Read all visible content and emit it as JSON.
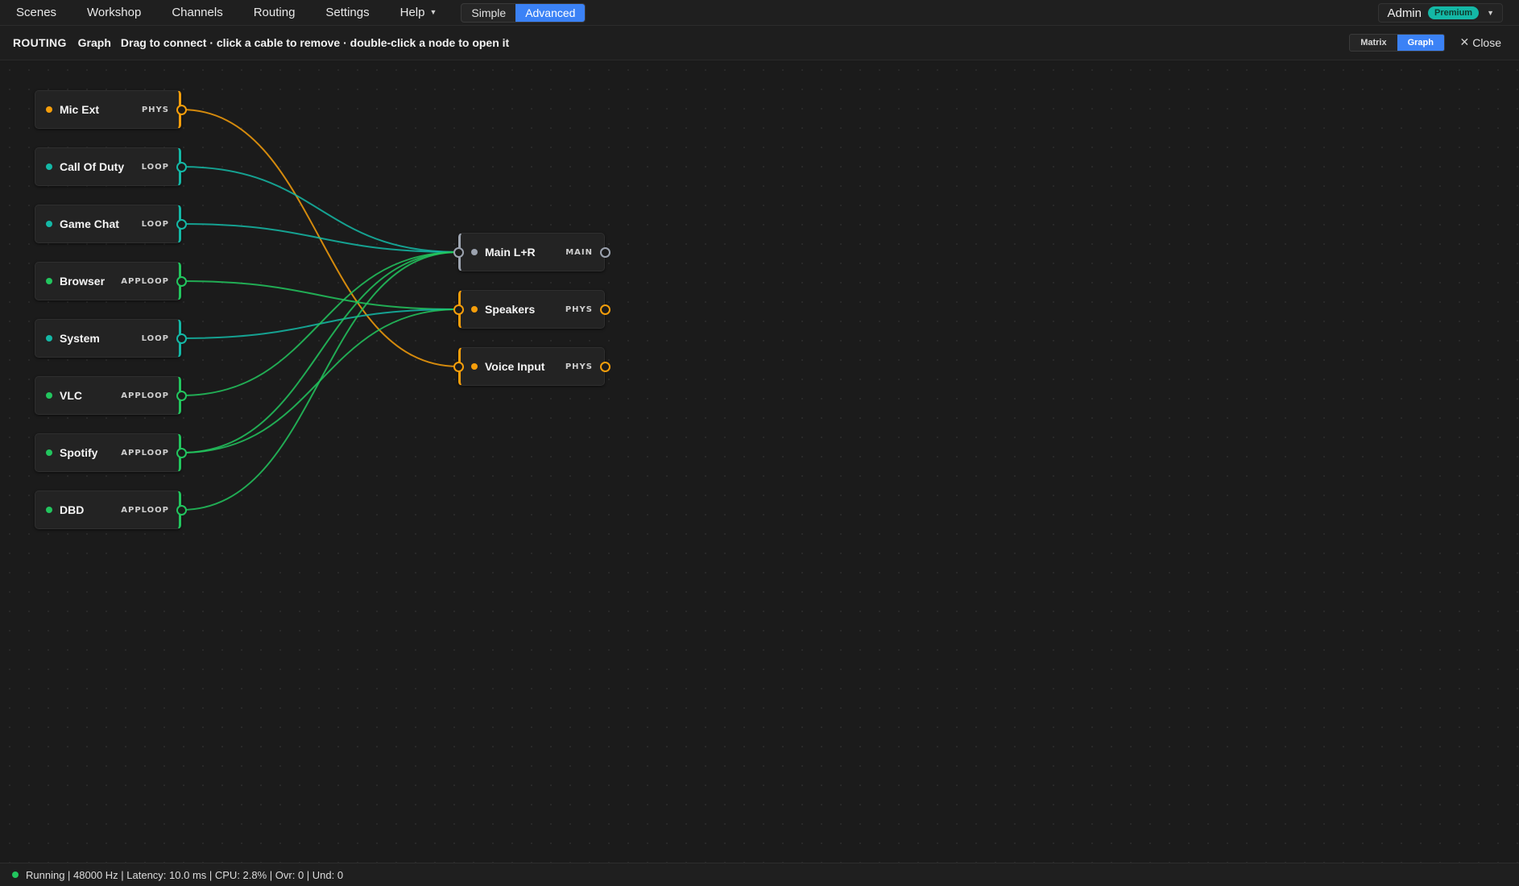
{
  "menu": {
    "items": [
      "Scenes",
      "Workshop",
      "Channels",
      "Routing",
      "Settings",
      "Help"
    ],
    "mode_simple": "Simple",
    "mode_advanced": "Advanced",
    "active_mode": "Advanced"
  },
  "account": {
    "name": "Admin",
    "badge": "Premium"
  },
  "routing_bar": {
    "title": "ROUTING",
    "subtitle": "Graph",
    "hint": "Drag to connect · click a cable to remove · double-click a node to open it",
    "view_matrix": "Matrix",
    "view_graph": "Graph",
    "active_view": "Graph",
    "close_label": "Close"
  },
  "colors": {
    "phys": "#f59e0b",
    "loop": "#14b8a6",
    "apploop": "#22c55e",
    "main": "#9ca3af",
    "accent": "#3b82f6"
  },
  "graph": {
    "sources": [
      {
        "id": "mic-ext",
        "label": "Mic Ext",
        "type": "PHYS",
        "kind": "phys"
      },
      {
        "id": "call-of-duty",
        "label": "Call Of Duty",
        "type": "LOOP",
        "kind": "loop"
      },
      {
        "id": "game-chat",
        "label": "Game Chat",
        "type": "LOOP",
        "kind": "loop"
      },
      {
        "id": "browser",
        "label": "Browser",
        "type": "APPLOOP",
        "kind": "apploop"
      },
      {
        "id": "system",
        "label": "System",
        "type": "LOOP",
        "kind": "loop"
      },
      {
        "id": "vlc",
        "label": "VLC",
        "type": "APPLOOP",
        "kind": "apploop"
      },
      {
        "id": "spotify",
        "label": "Spotify",
        "type": "APPLOOP",
        "kind": "apploop"
      },
      {
        "id": "dbd",
        "label": "DBD",
        "type": "APPLOOP",
        "kind": "apploop"
      }
    ],
    "destinations": [
      {
        "id": "main-lr",
        "label": "Main L+R",
        "type": "MAIN",
        "kind": "main"
      },
      {
        "id": "speakers",
        "label": "Speakers",
        "type": "PHYS",
        "kind": "phys"
      },
      {
        "id": "voice-input",
        "label": "Voice Input",
        "type": "PHYS",
        "kind": "phys"
      }
    ],
    "connections": [
      {
        "from": "mic-ext",
        "to": "voice-input"
      },
      {
        "from": "call-of-duty",
        "to": "main-lr"
      },
      {
        "from": "game-chat",
        "to": "main-lr"
      },
      {
        "from": "browser",
        "to": "speakers"
      },
      {
        "from": "system",
        "to": "speakers"
      },
      {
        "from": "vlc",
        "to": "main-lr"
      },
      {
        "from": "spotify",
        "to": "main-lr"
      },
      {
        "from": "spotify",
        "to": "speakers"
      },
      {
        "from": "dbd",
        "to": "main-lr"
      }
    ]
  },
  "status": {
    "text": "Running | 48000 Hz | Latency: 10.0 ms | CPU: 2.8% | Ovr: 0 | Und: 0"
  }
}
